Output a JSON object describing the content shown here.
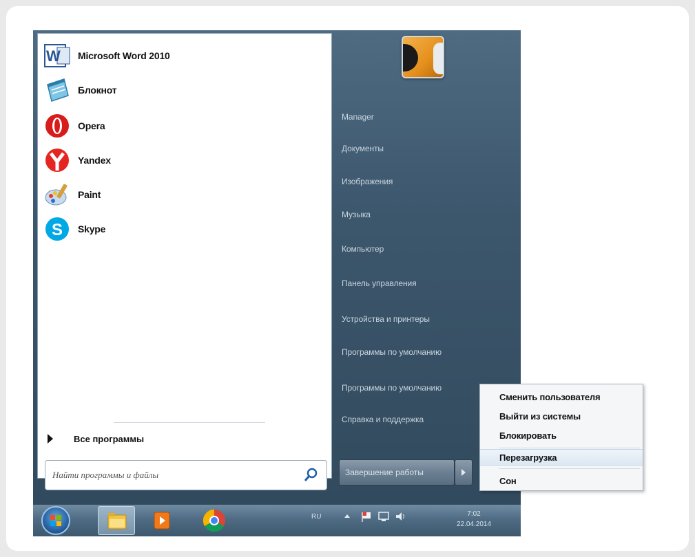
{
  "programs": [
    {
      "label": "Microsoft Word 2010",
      "icon": "word-icon"
    },
    {
      "label": "Блокнот",
      "icon": "notepad-icon"
    },
    {
      "label": "Opera",
      "icon": "opera-icon"
    },
    {
      "label": "Yandex",
      "icon": "yandex-icon"
    },
    {
      "label": "Paint",
      "icon": "paint-icon"
    },
    {
      "label": "Skype",
      "icon": "skype-icon"
    }
  ],
  "all_programs_label": "Все программы",
  "search": {
    "placeholder": "Найти программы и файлы"
  },
  "right_items": [
    "Manager",
    "Документы",
    "Изображения",
    "Музыка",
    "Компьютер",
    "Панель управления",
    "Устройства и принтеры",
    "Программы по умолчанию",
    "Программы по умолчанию",
    "Справка и поддержка"
  ],
  "shutdown_label": "Завершение работы",
  "context_menu": {
    "items": [
      "Сменить пользователя",
      "Выйти из системы",
      "Блокировать",
      "Перезагрузка",
      "Сон"
    ],
    "highlighted": "Перезагрузка"
  },
  "taskbar": {
    "language": "RU",
    "time": "7:02",
    "date": "22.04.2014"
  },
  "colors": {
    "start_panel_right": "#3c566c",
    "taskbar": "#4f6c84",
    "menu_highlight": "#dde8f3"
  }
}
